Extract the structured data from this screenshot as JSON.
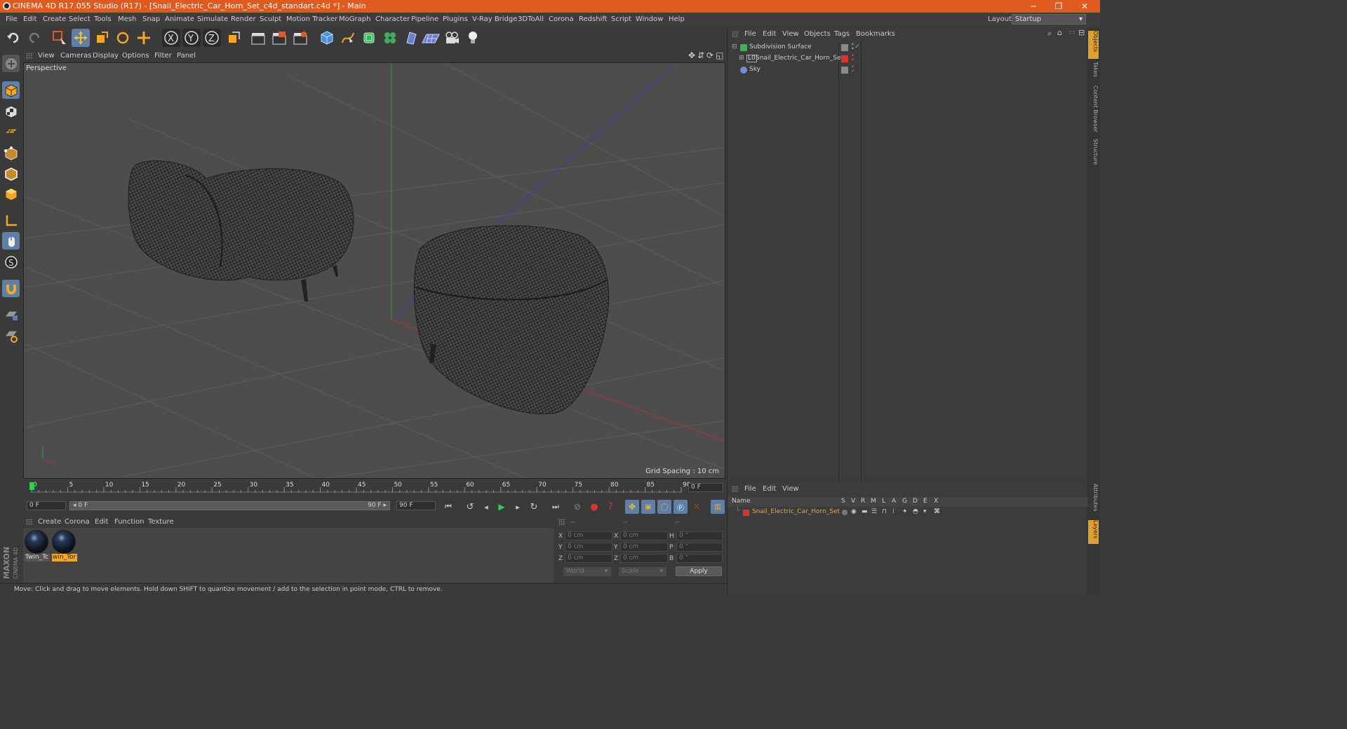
{
  "window": {
    "title": "CINEMA 4D R17.055 Studio (R17) - [Snail_Electric_Car_Horn_Set_c4d_standart.c4d *] - Main",
    "minimize": "─",
    "maximize": "❐",
    "close": "✕"
  },
  "menu": [
    "File",
    "Edit",
    "Create",
    "Select",
    "Tools",
    "Mesh",
    "Snap",
    "Animate",
    "Simulate",
    "Render",
    "Sculpt",
    "Motion Tracker",
    "MoGraph",
    "Character",
    "Pipeline",
    "Plugins",
    "V-Ray Bridge",
    "3DToAll",
    "Corona",
    "Redshift",
    "Script",
    "Window",
    "Help"
  ],
  "layout": {
    "label": "Layout:",
    "value": "Startup"
  },
  "viewport": {
    "menu": [
      "View",
      "Cameras",
      "Display",
      "Options",
      "Filter",
      "Panel"
    ],
    "label": "Perspective",
    "grid_spacing": "Grid Spacing : 10 cm"
  },
  "timeline": {
    "ticks": [
      "0",
      "5",
      "10",
      "15",
      "20",
      "25",
      "30",
      "35",
      "40",
      "45",
      "50",
      "55",
      "60",
      "65",
      "70",
      "75",
      "80",
      "85",
      "90"
    ],
    "current_frame": "0 F",
    "start": "0 F",
    "range_start": "0 F",
    "range_end": "90 F",
    "end": "90 F",
    "progress": 0
  },
  "materials": {
    "menu": [
      "Create",
      "Corona",
      "Edit",
      "Function",
      "Texture"
    ],
    "items": [
      {
        "label": "Twin_Tc"
      },
      {
        "label": "win_Tor"
      }
    ]
  },
  "coords": {
    "headers": [
      "--",
      "--",
      "--"
    ],
    "rows": [
      {
        "a": "X",
        "av": "0 cm",
        "b": "X",
        "bv": "0 cm",
        "c": "H",
        "cv": "0 °"
      },
      {
        "a": "Y",
        "av": "0 cm",
        "b": "Y",
        "bv": "0 cm",
        "c": "P",
        "cv": "0 °"
      },
      {
        "a": "Z",
        "av": "0 cm",
        "b": "Z",
        "bv": "0 cm",
        "c": "B",
        "cv": "0 °"
      }
    ],
    "world": "World",
    "scale": "Scale",
    "apply": "Apply"
  },
  "status": "Move: Click and drag to move elements. Hold down SHIFT to quantize movement / add to the selection in point mode, CTRL to remove.",
  "objects": {
    "menu": [
      "File",
      "Edit",
      "View",
      "Objects",
      "Tags",
      "Bookmarks"
    ],
    "items": [
      {
        "name": "Subdivision Surface"
      },
      {
        "name": "Snail_Electric_Car_Horn_Set"
      },
      {
        "name": "Sky"
      }
    ]
  },
  "layers": {
    "menu": [
      "File",
      "Edit",
      "View"
    ],
    "columns": [
      "Name",
      "S",
      "V",
      "R",
      "M",
      "L",
      "A",
      "G",
      "D",
      "E",
      "X"
    ],
    "items": [
      {
        "name": "Snail_Electric_Car_Horn_Set"
      }
    ]
  },
  "side_tabs": [
    "Objects",
    "Takes",
    "Content Browser",
    "Structure"
  ],
  "side_tabs_bottom": [
    "Attributes",
    "Layers"
  ],
  "brand": {
    "line1": "MAXON",
    "line2": "CINEMA 4D"
  },
  "colors": {
    "accent": "#e05a1e",
    "selection": "#f5a623",
    "active_tool": "#5e7fa8"
  }
}
